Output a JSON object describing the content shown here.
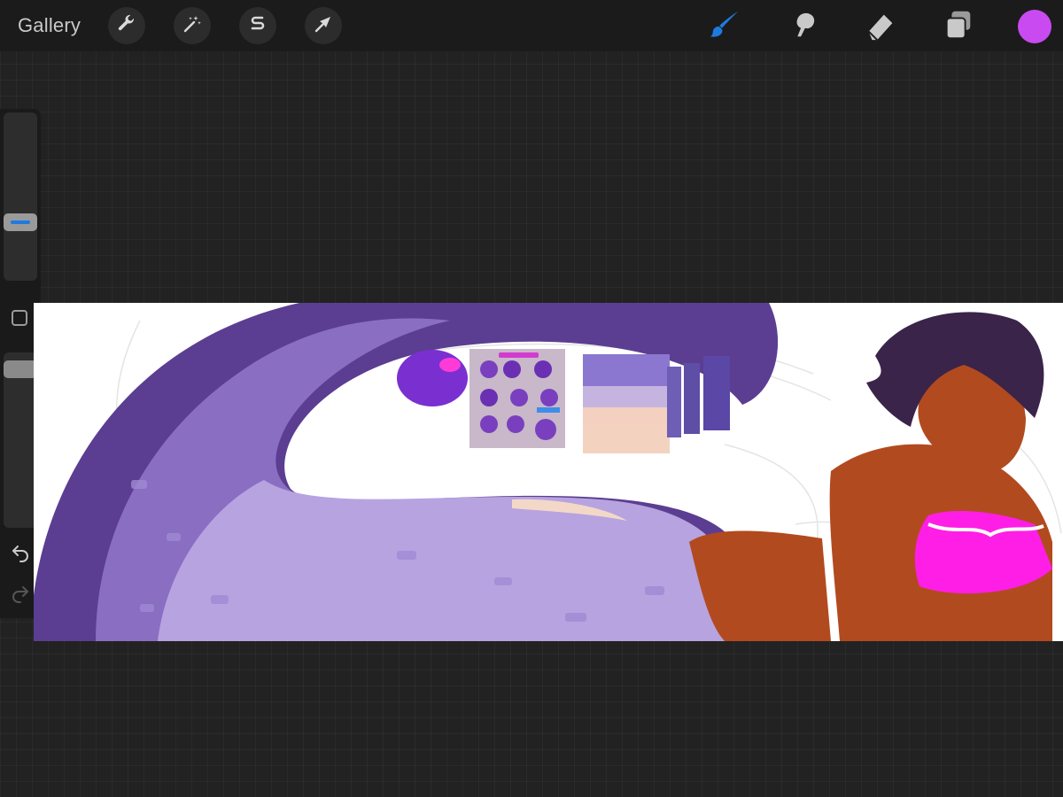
{
  "toolbar": {
    "gallery_label": "Gallery",
    "actions_icon": "wrench-icon",
    "adjustments_icon": "magic-wand-icon",
    "selection_icon": "selection-icon",
    "transform_icon": "transform-arrow-icon",
    "brush_icon": "brush-icon",
    "smudge_icon": "smudge-icon",
    "eraser_icon": "eraser-icon",
    "layers_icon": "layers-icon",
    "active_tool": "brush",
    "active_tool_color": "#1f7ae0",
    "current_color": "#c94af0"
  },
  "sidebar": {
    "brush_size_level": 0.33,
    "opacity_level": 0.05,
    "undo_icon": "undo-icon",
    "redo_icon": "redo-icon",
    "modify_icon": "square-icon"
  },
  "canvas": {
    "colors": {
      "purple_dark": "#5b3e91",
      "purple_mid": "#8a6ec2",
      "purple_light": "#b7a3e0",
      "skin": "#b24a1f",
      "hair": "#3a2449",
      "top": "#ff1ee6"
    }
  }
}
